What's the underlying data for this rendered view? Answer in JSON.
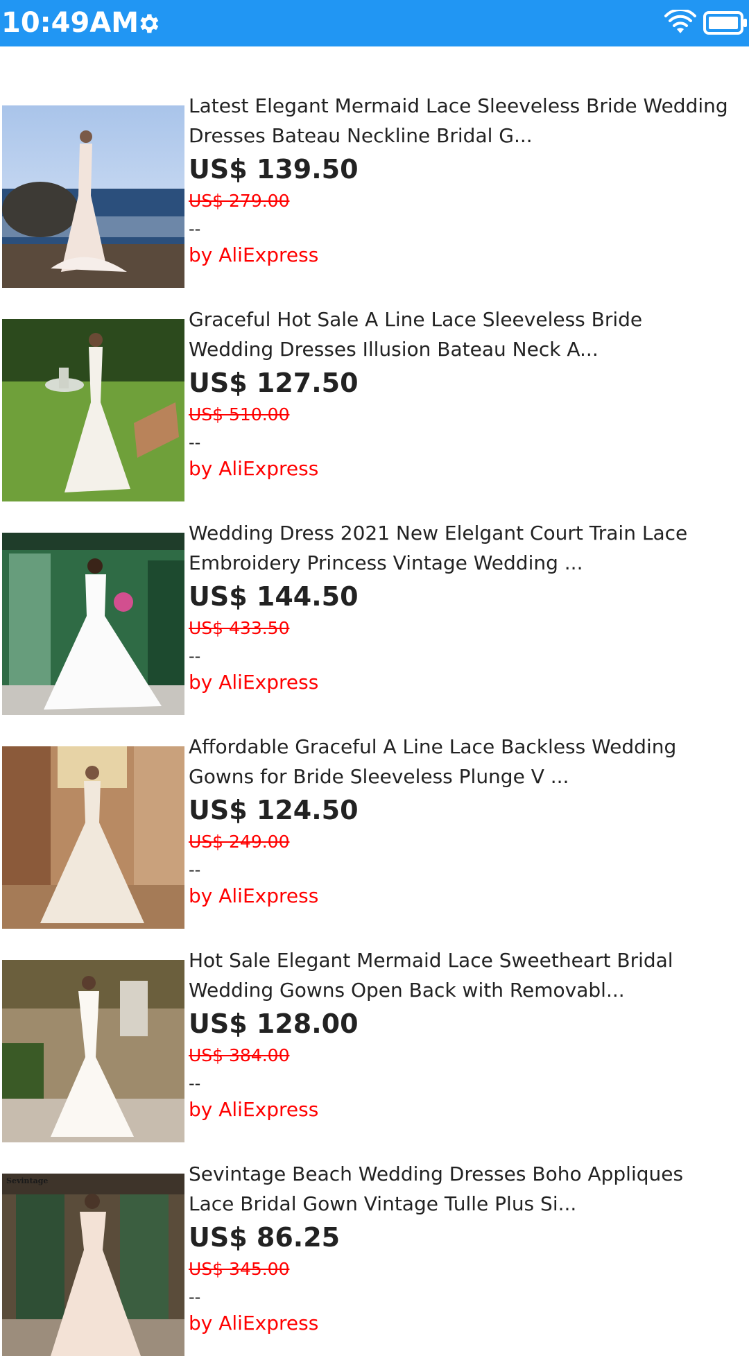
{
  "status_bar": {
    "time": "10:49AM",
    "icons": [
      "gear-icon",
      "wifi-icon",
      "battery-icon"
    ],
    "background_color": "#2196F3"
  },
  "colors": {
    "price_text": "#222222",
    "old_price": "#FF0000",
    "seller": "#FF0000"
  },
  "products": [
    {
      "title": "Latest Elegant Mermaid Lace Sleeveless Bride Wedding\nDresses Bateau Neckline Bridal G...",
      "price": "US$ 139.50",
      "old_price": "US$ 279.00",
      "rating": "--",
      "seller": "by AliExpress"
    },
    {
      "title": "Graceful Hot Sale A Line Lace Sleeveless Bride\nWedding Dresses Illusion Bateau Neck A...",
      "price": "US$ 127.50",
      "old_price": "US$ 510.00",
      "rating": "--",
      "seller": "by AliExpress"
    },
    {
      "title": "Wedding Dress 2021 New Elelgant Court Train Lace\nEmbroidery Princess Vintage Wedding ...",
      "price": "US$ 144.50",
      "old_price": "US$ 433.50",
      "rating": "--",
      "seller": "by AliExpress"
    },
    {
      "title": "Affordable Graceful A Line Lace Backless Wedding\nGowns for Bride Sleeveless Plunge V ...",
      "price": "US$ 124.50",
      "old_price": "US$ 249.00",
      "rating": "--",
      "seller": "by AliExpress"
    },
    {
      "title": "Hot Sale Elegant Mermaid Lace Sweetheart Bridal\nWedding Gowns Open Back with Removabl...",
      "price": "US$ 128.00",
      "old_price": "US$ 384.00",
      "rating": "--",
      "seller": "by AliExpress"
    },
    {
      "title": "Sevintage Beach Wedding Dresses Boho Appliques\nLace Bridal Gown Vintage Tulle Plus Si...",
      "price": "US$ 86.25",
      "old_price": "US$ 345.00",
      "rating": "--",
      "seller": "by AliExpress",
      "image_watermark": "Sevintage"
    }
  ]
}
